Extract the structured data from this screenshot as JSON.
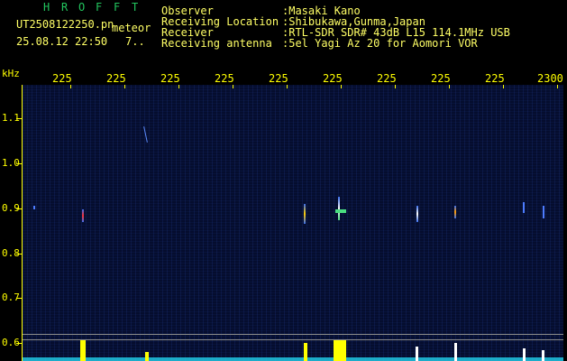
{
  "app": {
    "name_letters": [
      "H",
      "R",
      "O",
      "F",
      "F",
      "T"
    ],
    "filename": "UT2508122250.pn",
    "type_label": "meteor",
    "datetime": "25.08.12 22:50",
    "count": "7..",
    "colors": {
      "title": "#22c55e",
      "text": "#ffff66",
      "axis": "#ffff00",
      "background": "#000000"
    }
  },
  "info": {
    "labels": [
      "Observer",
      "Receiving Location",
      "Receiver",
      "Receiving antenna"
    ],
    "values": [
      ":Masaki Kano",
      ":Shibukawa,Gunma,Japan",
      ":RTL-SDR SDR# 43dB L15 114.1MHz USB",
      ":5el Yagi Az 20 for Aomori VOR"
    ]
  },
  "spectrogram": {
    "unit_label": "kHz",
    "freq_ticks": [
      "1.1",
      "1.0",
      "0.9",
      "0.8",
      "0.7",
      "0.6"
    ],
    "time_ticks": [
      "225",
      "225",
      "225",
      "225",
      "225",
      "225",
      "225",
      "225",
      "225",
      "2300"
    ]
  }
}
